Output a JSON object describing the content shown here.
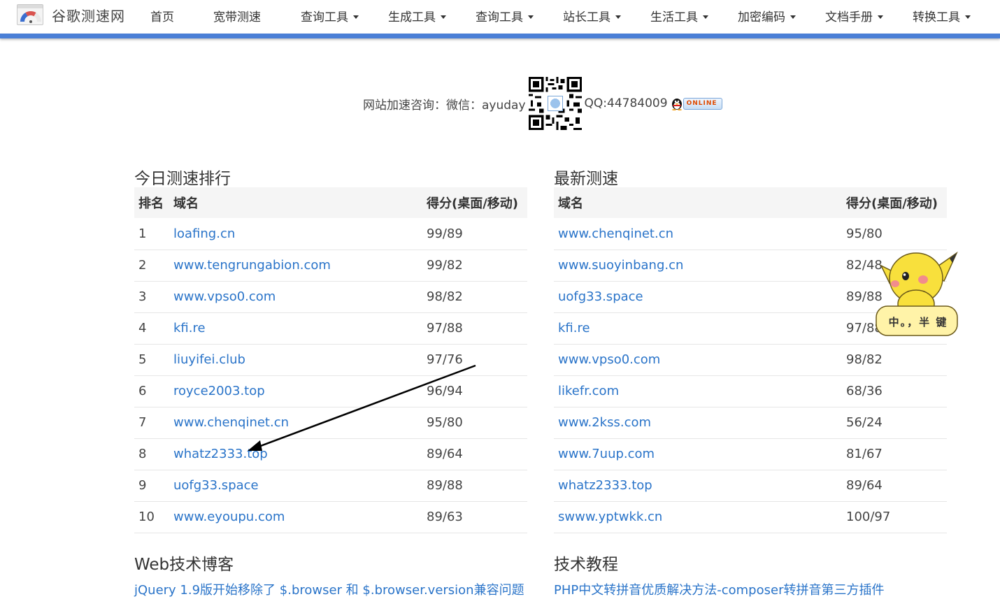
{
  "brand": {
    "name": "谷歌测速网"
  },
  "nav": [
    {
      "label": "首页",
      "dropdown": false
    },
    {
      "label": "宽带测速",
      "dropdown": false
    },
    {
      "label": "查询工具",
      "dropdown": true
    },
    {
      "label": "生成工具",
      "dropdown": true
    },
    {
      "label": "查询工具",
      "dropdown": true
    },
    {
      "label": "站长工具",
      "dropdown": true
    },
    {
      "label": "生活工具",
      "dropdown": true
    },
    {
      "label": "加密编码",
      "dropdown": true
    },
    {
      "label": "文档手册",
      "dropdown": true
    },
    {
      "label": "转换工具",
      "dropdown": true
    }
  ],
  "contact": {
    "prefix": "网站加速咨询：微信：ayuday",
    "qq": "QQ:44784009",
    "online": "ONLINE"
  },
  "today": {
    "title": "今日测速排行",
    "headers": {
      "rank": "排名",
      "domain": "域名",
      "score": "得分(桌面/移动)"
    },
    "rows": [
      {
        "rank": "1",
        "domain": "loafing.cn",
        "score": "99/89"
      },
      {
        "rank": "2",
        "domain": "www.tengrungabion.com",
        "score": "99/82"
      },
      {
        "rank": "3",
        "domain": "www.vpso0.com",
        "score": "98/82"
      },
      {
        "rank": "4",
        "domain": "kfi.re",
        "score": "97/88"
      },
      {
        "rank": "5",
        "domain": "liuyifei.club",
        "score": "97/76"
      },
      {
        "rank": "6",
        "domain": "royce2003.top",
        "score": "96/94"
      },
      {
        "rank": "7",
        "domain": "www.chenqinet.cn",
        "score": "95/80"
      },
      {
        "rank": "8",
        "domain": "whatz2333.top",
        "score": "89/64"
      },
      {
        "rank": "9",
        "domain": "uofg33.space",
        "score": "89/88"
      },
      {
        "rank": "10",
        "domain": "www.eyoupu.com",
        "score": "89/63"
      }
    ]
  },
  "latest": {
    "title": "最新测速",
    "headers": {
      "domain": "域名",
      "score": "得分(桌面/移动)"
    },
    "rows": [
      {
        "domain": "www.chenqinet.cn",
        "score": "95/80"
      },
      {
        "domain": "www.suoyinbang.cn",
        "score": "82/48"
      },
      {
        "domain": "uofg33.space",
        "score": "89/88"
      },
      {
        "domain": "kfi.re",
        "score": "97/88"
      },
      {
        "domain": "www.vpso0.com",
        "score": "98/82"
      },
      {
        "domain": "likefr.com",
        "score": "68/36"
      },
      {
        "domain": "www.2kss.com",
        "score": "56/24"
      },
      {
        "domain": "www.7uup.com",
        "score": "81/67"
      },
      {
        "domain": "whatz2333.top",
        "score": "89/64"
      },
      {
        "domain": "swww.yptwkk.cn",
        "score": "100/97"
      }
    ]
  },
  "blog": {
    "title": "Web技术博客",
    "first_post": "jQuery 1.9版开始移除了 $.browser 和 $.browser.version兼容问题"
  },
  "tutorial": {
    "title": "技术教程",
    "first_post": "PHP中文转拼音优质解决方法-composer转拼音第三方插件"
  },
  "mascot": {
    "text": "中。，半 键"
  },
  "colors": {
    "accent": "#4a7fd6",
    "link": "#2a74c9",
    "header_bg": "#f5f5f5"
  }
}
